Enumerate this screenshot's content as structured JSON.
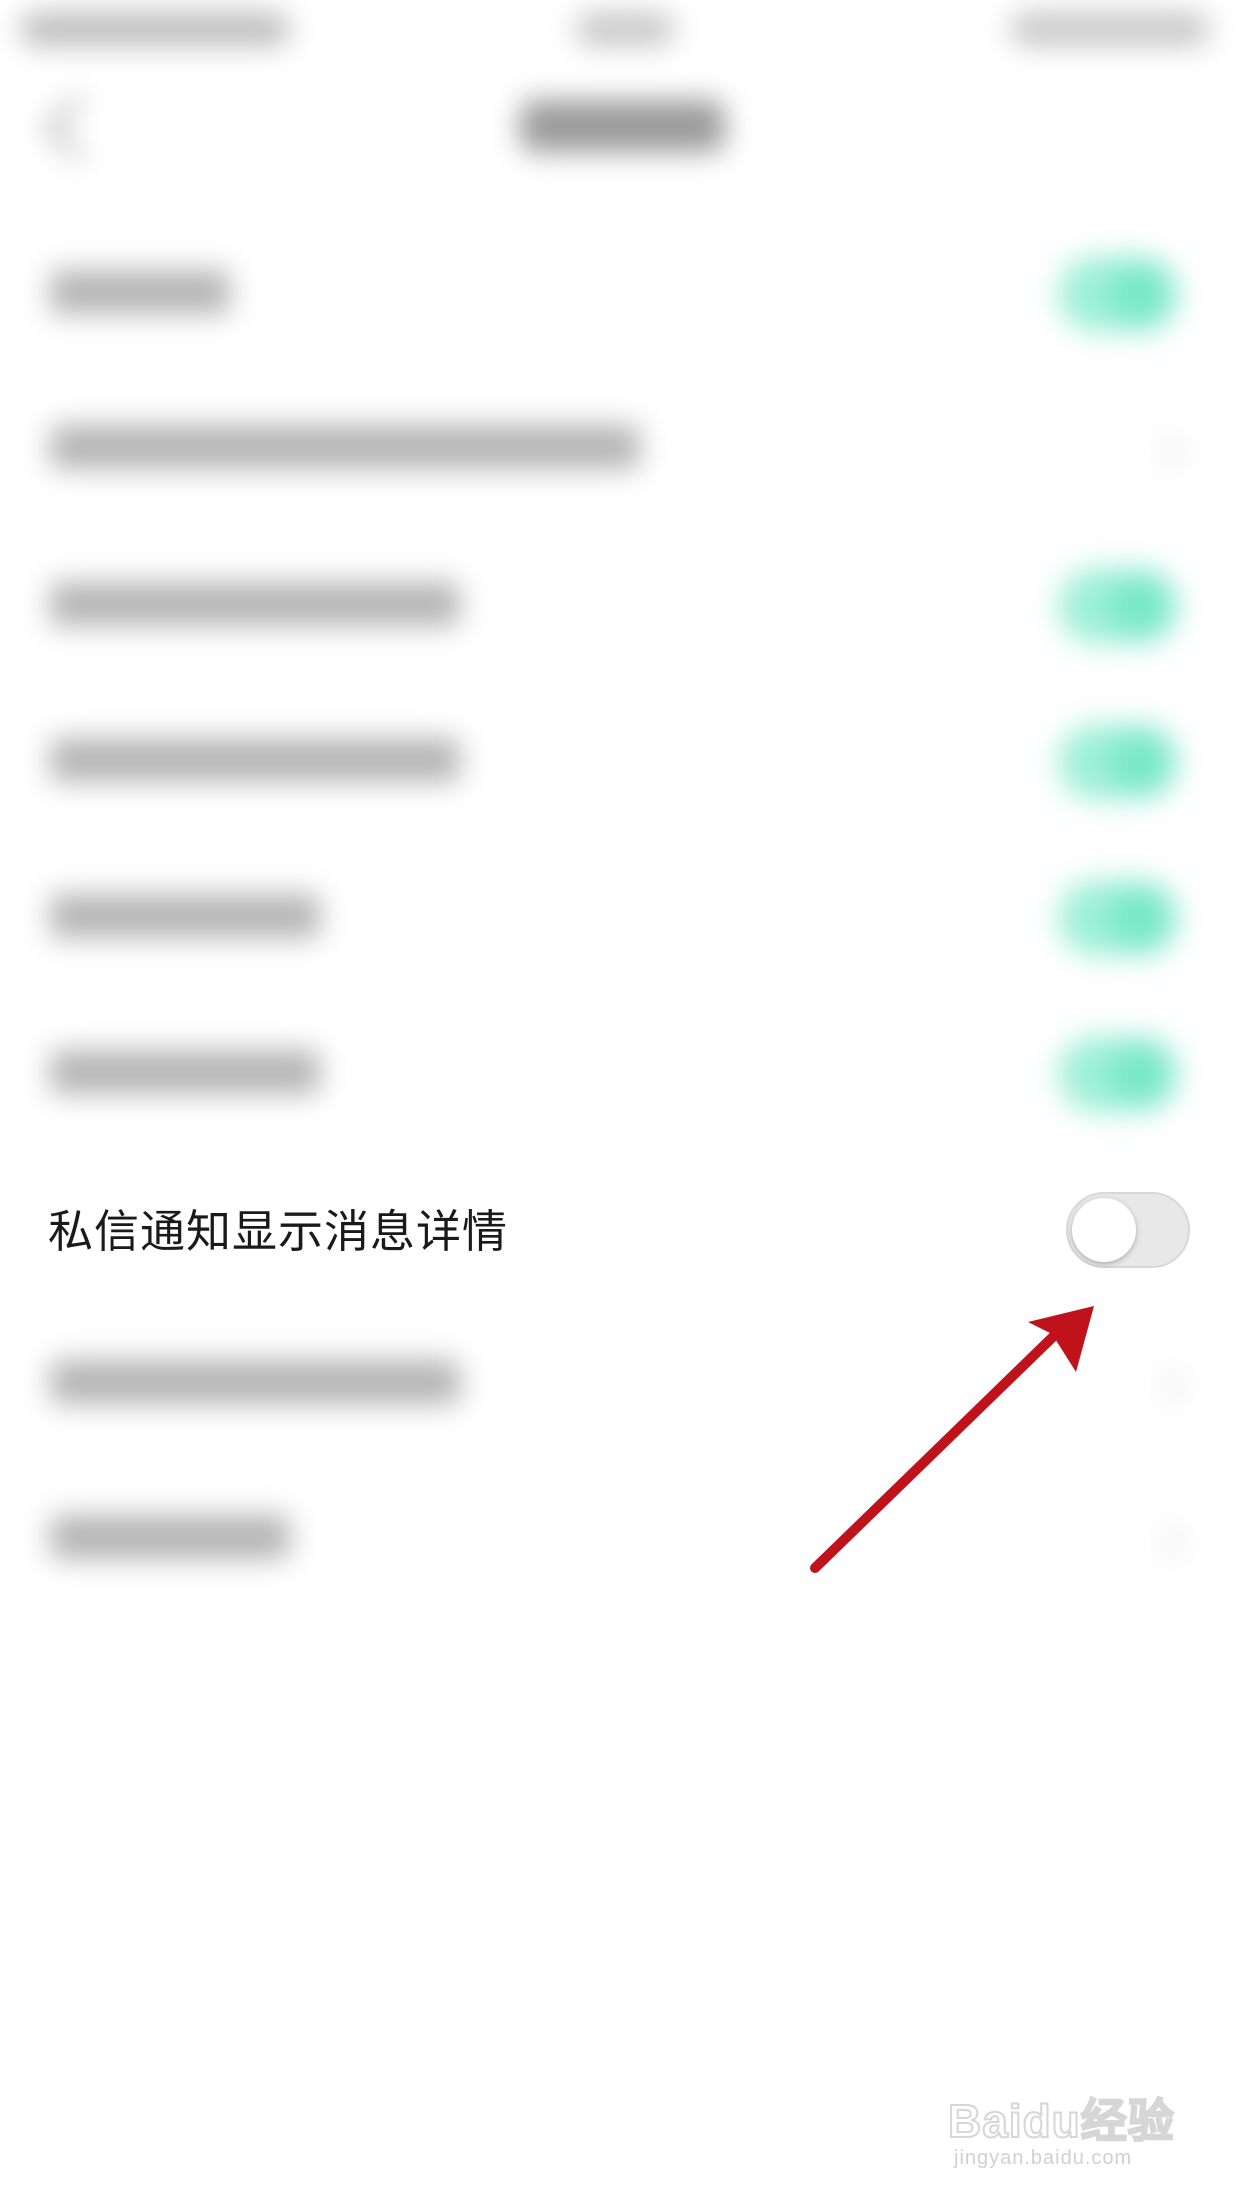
{
  "settings": {
    "private_message_detail": {
      "label": "私信通知显示消息详情",
      "enabled": false
    }
  },
  "colors": {
    "toggle_on": "#7ae8c8",
    "toggle_off": "#e8e8e8",
    "annotation_arrow": "#c0121a"
  },
  "watermark": {
    "logo": "Baidu经验",
    "url": "jingyan.baidu.com"
  }
}
